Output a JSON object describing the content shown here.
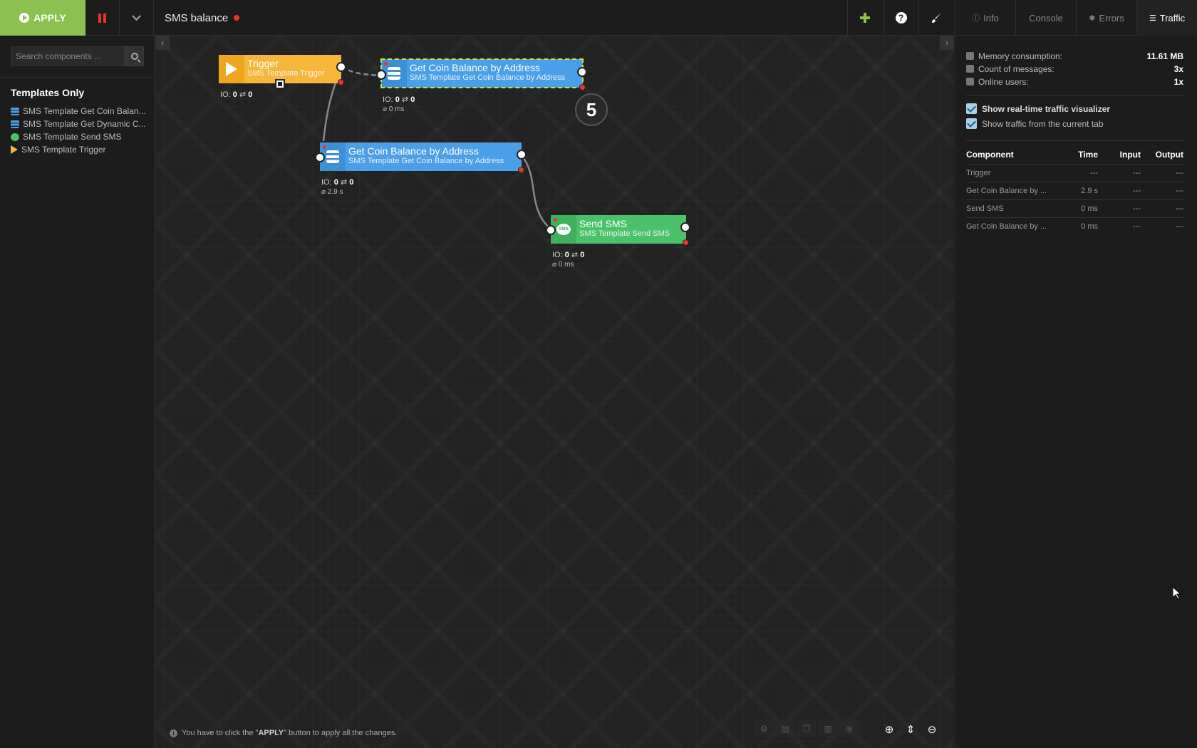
{
  "toolbar": {
    "apply_label": "APPLY",
    "flow_title": "SMS balance"
  },
  "right_tabs": [
    {
      "label": "Info",
      "icon": "info-icon"
    },
    {
      "label": "Console",
      "icon": ""
    },
    {
      "label": "Errors",
      "icon": "bug-icon"
    },
    {
      "label": "Traffic",
      "icon": "list-icon"
    }
  ],
  "sidebar": {
    "search_placeholder": "Search components ...",
    "group_title": "Templates Only",
    "items": [
      {
        "label": "SMS Template Get Coin Balan...",
        "icon": "database-icon"
      },
      {
        "label": "SMS Template Get Dynamic C...",
        "icon": "database-icon"
      },
      {
        "label": "SMS Template Send SMS",
        "icon": "chat-icon"
      },
      {
        "label": "SMS Template Trigger",
        "icon": "play-icon"
      }
    ]
  },
  "nodes": {
    "trigger": {
      "title": "Trigger",
      "subtitle": "SMS Template Trigger",
      "io": "IO:",
      "in": "0",
      "out": "0",
      "color": "#f6b53b"
    },
    "coin1": {
      "title": "Get Coin Balance by Address",
      "subtitle": "SMS Template Get Coin Balance by Address",
      "io": "IO:",
      "in": "0",
      "out": "0",
      "ms": "⌀ 0 ms",
      "color": "#4a9fe8"
    },
    "coin2": {
      "title": "Get Coin Balance by Address",
      "subtitle": "SMS Template Get Coin Balance by Address",
      "io": "IO:",
      "in": "0",
      "out": "0",
      "ms": "⌀ 2.9 s",
      "color": "#4a9fe8"
    },
    "sms": {
      "title": "Send SMS",
      "subtitle": "SMS Template Send SMS",
      "io": "IO:",
      "in": "0",
      "out": "0",
      "ms": "⌀ 0 ms",
      "color": "#4cc16b"
    },
    "counter": "5"
  },
  "hint": {
    "pre": "You have to click the \"",
    "bold": "APPLY",
    "post": "\" button to apply all the changes."
  },
  "stats": {
    "memory_label": "Memory consumption:",
    "memory_value": "11.61 MB",
    "messages_label": "Count of messages:",
    "messages_value": "3x",
    "users_label": "Online users:",
    "users_value": "1x"
  },
  "options": {
    "visualizer": "Show real-time traffic visualizer",
    "current_tab": "Show traffic from the current tab"
  },
  "traffic": {
    "headers": [
      "Component",
      "Time",
      "Input",
      "Output"
    ],
    "rows": [
      [
        "Trigger",
        "---",
        "---",
        "---"
      ],
      [
        "Get Coin Balance by ...",
        "2.9 s",
        "---",
        "---"
      ],
      [
        "Send SMS",
        "0 ms",
        "---",
        "---"
      ],
      [
        "Get Coin Balance by ...",
        "0 ms",
        "---",
        "---"
      ]
    ]
  },
  "colors": {
    "accent": "#8cc152",
    "error": "#e8352b",
    "background": "#222222"
  }
}
